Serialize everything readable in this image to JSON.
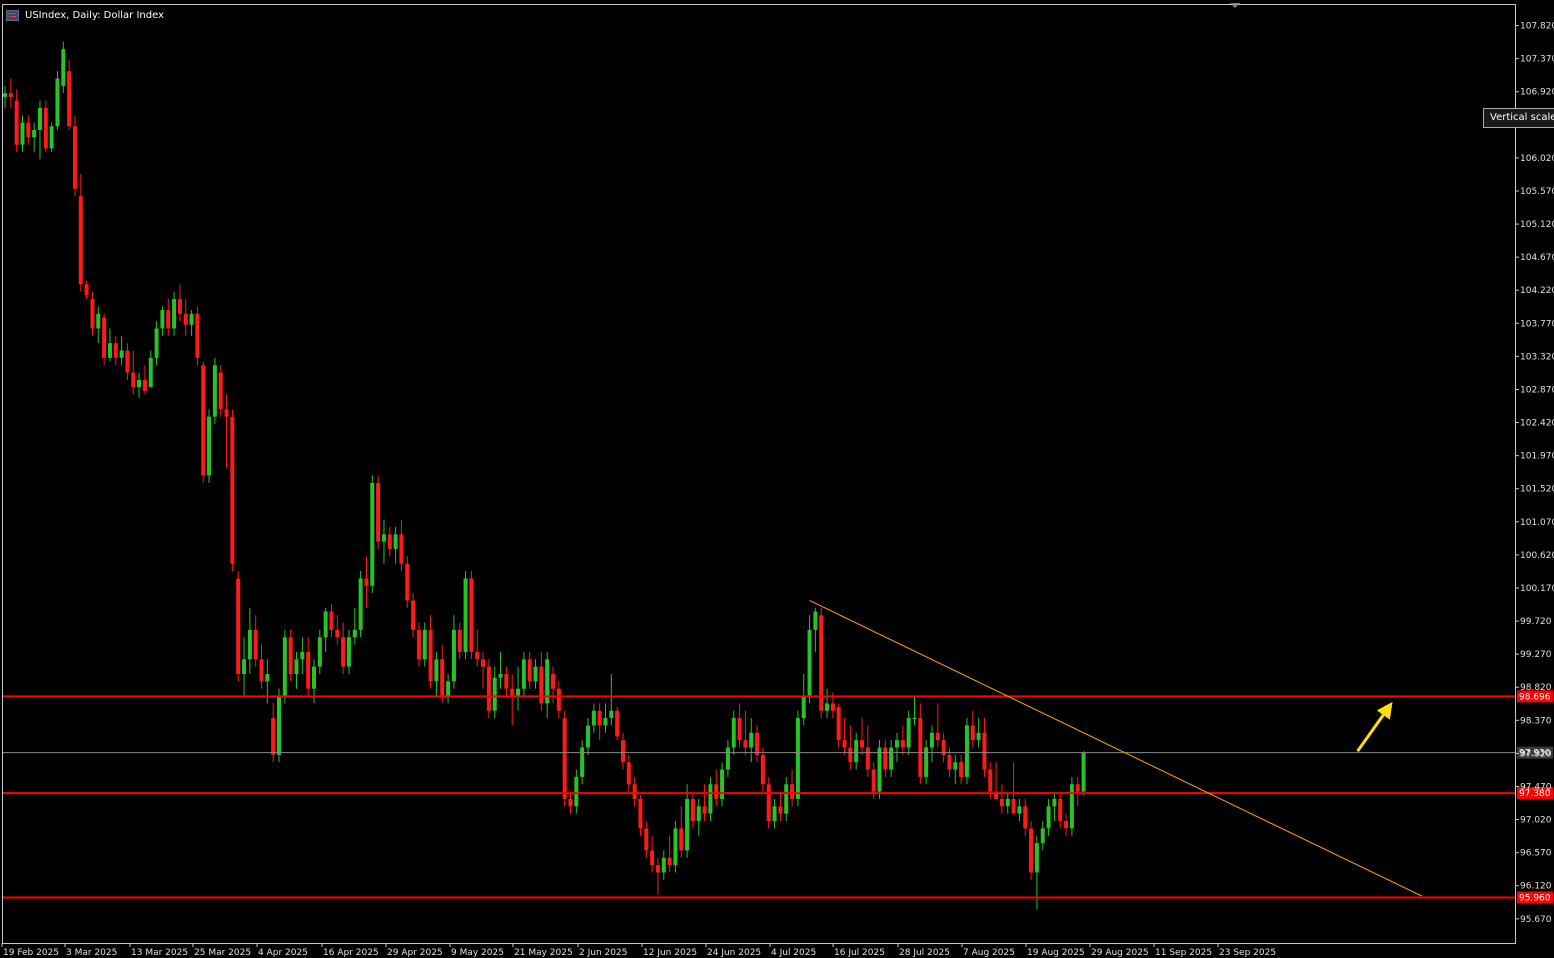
{
  "window": {
    "title": "USIndex, Daily:  Dollar Index",
    "tooltip": "Vertical scale"
  },
  "colors": {
    "background": "#000000",
    "bull_candle": "#26c426",
    "bear_candle": "#ff1a1a",
    "horizontal_level": "#ff0000",
    "trendline": "#ffa500",
    "arrow": "#ffe000",
    "current_price_line": "#8a8a8a",
    "axis": "#c8c8c8"
  },
  "chart_data": {
    "type": "candlestick",
    "symbol": "USIndex",
    "timeframe": "Daily",
    "title": "USIndex, Daily:  Dollar Index",
    "ylim": [
      95.3,
      108.1
    ],
    "y_ticks": [
      "107.820",
      "107.370",
      "106.920",
      "106.470",
      "106.020",
      "105.570",
      "105.120",
      "104.670",
      "104.220",
      "103.770",
      "103.320",
      "102.870",
      "102.420",
      "101.970",
      "101.520",
      "101.070",
      "100.620",
      "100.170",
      "99.720",
      "99.270",
      "98.820",
      "98.370",
      "97.920",
      "97.470",
      "97.020",
      "96.570",
      "96.120",
      "95.670"
    ],
    "x_ticks": [
      "19 Feb 2025",
      "3 Mar 2025",
      "13 Mar 2025",
      "25 Mar 2025",
      "4 Apr 2025",
      "16 Apr 2025",
      "29 Apr 2025",
      "9 May 2025",
      "21 May 2025",
      "2 Jun 2025",
      "12 Jun 2025",
      "24 Jun 2025",
      "4 Jul 2025",
      "16 Jul 2025",
      "28 Jul 2025",
      "7 Aug 2025",
      "19 Aug 2025",
      "29 Aug 2025",
      "11 Sep 2025",
      "23 Sep 2025"
    ],
    "grid": false,
    "horizontal_levels": [
      {
        "price": 98.696,
        "label": "98.696"
      },
      {
        "price": 97.38,
        "label": "97.380"
      },
      {
        "price": 95.96,
        "label": "95.960"
      }
    ],
    "current_price": {
      "price": 97.93,
      "label": "97.930"
    },
    "trendline": {
      "from": {
        "index": 138,
        "price": 100.0
      },
      "to": {
        "index": 243,
        "price": 95.98
      }
    },
    "arrow": {
      "from": {
        "index": 232,
        "price": 97.95
      },
      "to": {
        "index": 238,
        "price": 98.62
      }
    },
    "candles": [
      {
        "o": 106.85,
        "h": 107.0,
        "l": 106.7,
        "c": 106.9
      },
      {
        "o": 106.9,
        "h": 107.1,
        "l": 106.7,
        "c": 106.85
      },
      {
        "o": 106.8,
        "h": 106.95,
        "l": 106.1,
        "c": 106.2
      },
      {
        "o": 106.2,
        "h": 106.6,
        "l": 106.1,
        "c": 106.5
      },
      {
        "o": 106.5,
        "h": 106.6,
        "l": 106.2,
        "c": 106.3
      },
      {
        "o": 106.3,
        "h": 106.5,
        "l": 106.1,
        "c": 106.4
      },
      {
        "o": 106.4,
        "h": 106.8,
        "l": 106.0,
        "c": 106.7
      },
      {
        "o": 106.7,
        "h": 106.8,
        "l": 106.1,
        "c": 106.15
      },
      {
        "o": 106.15,
        "h": 106.5,
        "l": 106.1,
        "c": 106.45
      },
      {
        "o": 106.45,
        "h": 107.2,
        "l": 106.4,
        "c": 107.1
      },
      {
        "o": 107.0,
        "h": 107.6,
        "l": 106.9,
        "c": 107.5
      },
      {
        "o": 107.2,
        "h": 107.35,
        "l": 106.4,
        "c": 106.45
      },
      {
        "o": 106.45,
        "h": 106.6,
        "l": 105.5,
        "c": 105.6
      },
      {
        "o": 105.5,
        "h": 105.8,
        "l": 104.2,
        "c": 104.3
      },
      {
        "o": 104.3,
        "h": 104.35,
        "l": 104.1,
        "c": 104.15
      },
      {
        "o": 104.1,
        "h": 104.2,
        "l": 103.6,
        "c": 103.7
      },
      {
        "o": 103.7,
        "h": 104.0,
        "l": 103.5,
        "c": 103.9
      },
      {
        "o": 103.85,
        "h": 103.9,
        "l": 103.2,
        "c": 103.3
      },
      {
        "o": 103.3,
        "h": 103.7,
        "l": 103.25,
        "c": 103.5
      },
      {
        "o": 103.5,
        "h": 103.6,
        "l": 103.2,
        "c": 103.3
      },
      {
        "o": 103.3,
        "h": 103.6,
        "l": 103.2,
        "c": 103.4
      },
      {
        "o": 103.4,
        "h": 103.5,
        "l": 103.0,
        "c": 103.1
      },
      {
        "o": 103.1,
        "h": 103.4,
        "l": 102.8,
        "c": 102.9
      },
      {
        "o": 102.9,
        "h": 103.1,
        "l": 102.75,
        "c": 103.0
      },
      {
        "o": 103.0,
        "h": 103.2,
        "l": 102.8,
        "c": 102.85
      },
      {
        "o": 102.9,
        "h": 103.4,
        "l": 102.9,
        "c": 103.3
      },
      {
        "o": 103.3,
        "h": 103.8,
        "l": 103.2,
        "c": 103.7
      },
      {
        "o": 103.7,
        "h": 104.0,
        "l": 103.6,
        "c": 103.95
      },
      {
        "o": 103.95,
        "h": 104.1,
        "l": 103.6,
        "c": 103.7
      },
      {
        "o": 103.7,
        "h": 104.2,
        "l": 103.6,
        "c": 104.1
      },
      {
        "o": 104.1,
        "h": 104.3,
        "l": 103.8,
        "c": 103.9
      },
      {
        "o": 103.9,
        "h": 104.1,
        "l": 103.6,
        "c": 103.75
      },
      {
        "o": 103.75,
        "h": 103.95,
        "l": 103.6,
        "c": 103.9
      },
      {
        "o": 103.9,
        "h": 104.0,
        "l": 103.2,
        "c": 103.3
      },
      {
        "o": 103.2,
        "h": 103.25,
        "l": 101.6,
        "c": 101.7
      },
      {
        "o": 101.7,
        "h": 102.6,
        "l": 101.6,
        "c": 102.5
      },
      {
        "o": 102.5,
        "h": 103.3,
        "l": 102.4,
        "c": 103.2
      },
      {
        "o": 103.1,
        "h": 103.2,
        "l": 102.5,
        "c": 102.6
      },
      {
        "o": 102.6,
        "h": 102.8,
        "l": 101.8,
        "c": 102.5
      },
      {
        "o": 102.5,
        "h": 102.6,
        "l": 100.4,
        "c": 100.5
      },
      {
        "o": 100.3,
        "h": 100.4,
        "l": 98.9,
        "c": 99.0
      },
      {
        "o": 99.0,
        "h": 99.5,
        "l": 98.7,
        "c": 99.2
      },
      {
        "o": 99.2,
        "h": 99.9,
        "l": 99.0,
        "c": 99.6
      },
      {
        "o": 99.6,
        "h": 99.8,
        "l": 99.1,
        "c": 99.2
      },
      {
        "o": 99.2,
        "h": 99.4,
        "l": 98.8,
        "c": 98.9
      },
      {
        "o": 98.9,
        "h": 99.2,
        "l": 98.6,
        "c": 99.0
      },
      {
        "o": 98.4,
        "h": 98.6,
        "l": 97.8,
        "c": 97.9
      },
      {
        "o": 97.9,
        "h": 98.8,
        "l": 97.8,
        "c": 98.7
      },
      {
        "o": 98.7,
        "h": 99.6,
        "l": 98.6,
        "c": 99.5
      },
      {
        "o": 99.5,
        "h": 99.6,
        "l": 98.9,
        "c": 99.0
      },
      {
        "o": 99.0,
        "h": 99.3,
        "l": 98.8,
        "c": 99.2
      },
      {
        "o": 99.2,
        "h": 99.5,
        "l": 99.0,
        "c": 99.3
      },
      {
        "o": 99.3,
        "h": 99.5,
        "l": 98.7,
        "c": 98.8
      },
      {
        "o": 98.8,
        "h": 99.2,
        "l": 98.6,
        "c": 99.1
      },
      {
        "o": 99.1,
        "h": 99.6,
        "l": 99.0,
        "c": 99.5
      },
      {
        "o": 99.5,
        "h": 99.9,
        "l": 99.3,
        "c": 99.85
      },
      {
        "o": 99.85,
        "h": 99.95,
        "l": 99.5,
        "c": 99.6
      },
      {
        "o": 99.6,
        "h": 99.8,
        "l": 99.4,
        "c": 99.5
      },
      {
        "o": 99.5,
        "h": 99.7,
        "l": 99.0,
        "c": 99.1
      },
      {
        "o": 99.1,
        "h": 99.6,
        "l": 99.0,
        "c": 99.5
      },
      {
        "o": 99.5,
        "h": 99.9,
        "l": 99.4,
        "c": 99.6
      },
      {
        "o": 99.6,
        "h": 100.4,
        "l": 99.5,
        "c": 100.3
      },
      {
        "o": 100.3,
        "h": 100.6,
        "l": 99.9,
        "c": 100.2
      },
      {
        "o": 100.2,
        "h": 101.7,
        "l": 100.1,
        "c": 101.6
      },
      {
        "o": 101.6,
        "h": 101.7,
        "l": 100.7,
        "c": 100.8
      },
      {
        "o": 100.8,
        "h": 101.1,
        "l": 100.5,
        "c": 100.9
      },
      {
        "o": 100.9,
        "h": 101.0,
        "l": 100.6,
        "c": 100.7
      },
      {
        "o": 100.7,
        "h": 101.0,
        "l": 100.5,
        "c": 100.9
      },
      {
        "o": 100.9,
        "h": 101.1,
        "l": 100.4,
        "c": 100.5
      },
      {
        "o": 100.5,
        "h": 100.6,
        "l": 99.9,
        "c": 100.0
      },
      {
        "o": 100.0,
        "h": 100.1,
        "l": 99.5,
        "c": 99.6
      },
      {
        "o": 99.6,
        "h": 99.7,
        "l": 99.1,
        "c": 99.2
      },
      {
        "o": 99.2,
        "h": 99.7,
        "l": 99.1,
        "c": 99.6
      },
      {
        "o": 99.6,
        "h": 99.8,
        "l": 98.8,
        "c": 98.9
      },
      {
        "o": 98.9,
        "h": 99.3,
        "l": 98.7,
        "c": 99.2
      },
      {
        "o": 99.2,
        "h": 99.4,
        "l": 98.6,
        "c": 98.7
      },
      {
        "o": 98.7,
        "h": 99.0,
        "l": 98.6,
        "c": 98.9
      },
      {
        "o": 98.9,
        "h": 99.8,
        "l": 98.8,
        "c": 99.6
      },
      {
        "o": 99.6,
        "h": 99.7,
        "l": 99.2,
        "c": 99.3
      },
      {
        "o": 99.3,
        "h": 100.4,
        "l": 99.2,
        "c": 100.3
      },
      {
        "o": 100.3,
        "h": 100.4,
        "l": 99.2,
        "c": 99.3
      },
      {
        "o": 99.3,
        "h": 99.6,
        "l": 99.1,
        "c": 99.2
      },
      {
        "o": 99.2,
        "h": 99.3,
        "l": 98.8,
        "c": 99.1
      },
      {
        "o": 99.1,
        "h": 99.2,
        "l": 98.4,
        "c": 98.5
      },
      {
        "o": 98.5,
        "h": 99.1,
        "l": 98.4,
        "c": 98.95
      },
      {
        "o": 98.95,
        "h": 99.3,
        "l": 98.8,
        "c": 99.0
      },
      {
        "o": 99.0,
        "h": 99.1,
        "l": 98.7,
        "c": 98.8
      },
      {
        "o": 98.8,
        "h": 99.0,
        "l": 98.3,
        "c": 98.7
      },
      {
        "o": 98.7,
        "h": 99.1,
        "l": 98.5,
        "c": 98.8
      },
      {
        "o": 98.8,
        "h": 99.3,
        "l": 98.7,
        "c": 99.2
      },
      {
        "o": 99.2,
        "h": 99.3,
        "l": 98.8,
        "c": 98.9
      },
      {
        "o": 98.9,
        "h": 99.2,
        "l": 98.8,
        "c": 99.1
      },
      {
        "o": 99.1,
        "h": 99.3,
        "l": 98.5,
        "c": 98.6
      },
      {
        "o": 98.6,
        "h": 99.3,
        "l": 98.4,
        "c": 99.2
      },
      {
        "o": 99.0,
        "h": 99.1,
        "l": 98.6,
        "c": 98.8
      },
      {
        "o": 98.8,
        "h": 98.9,
        "l": 98.4,
        "c": 98.5
      },
      {
        "o": 98.4,
        "h": 98.5,
        "l": 97.2,
        "c": 97.3
      },
      {
        "o": 97.3,
        "h": 97.4,
        "l": 97.1,
        "c": 97.2
      },
      {
        "o": 97.2,
        "h": 97.7,
        "l": 97.1,
        "c": 97.6
      },
      {
        "o": 97.6,
        "h": 98.1,
        "l": 97.5,
        "c": 98.0
      },
      {
        "o": 98.0,
        "h": 98.4,
        "l": 97.9,
        "c": 98.3
      },
      {
        "o": 98.3,
        "h": 98.6,
        "l": 98.2,
        "c": 98.5
      },
      {
        "o": 98.5,
        "h": 98.6,
        "l": 98.1,
        "c": 98.3
      },
      {
        "o": 98.3,
        "h": 98.6,
        "l": 98.2,
        "c": 98.4
      },
      {
        "o": 98.4,
        "h": 99.0,
        "l": 98.3,
        "c": 98.5
      },
      {
        "o": 98.5,
        "h": 98.55,
        "l": 98.1,
        "c": 98.15
      },
      {
        "o": 98.1,
        "h": 98.2,
        "l": 97.7,
        "c": 97.8
      },
      {
        "o": 97.8,
        "h": 97.9,
        "l": 97.4,
        "c": 97.5
      },
      {
        "o": 97.5,
        "h": 97.6,
        "l": 97.2,
        "c": 97.3
      },
      {
        "o": 97.3,
        "h": 97.35,
        "l": 96.8,
        "c": 96.9
      },
      {
        "o": 96.9,
        "h": 97.0,
        "l": 96.5,
        "c": 96.6
      },
      {
        "o": 96.6,
        "h": 96.8,
        "l": 96.3,
        "c": 96.4
      },
      {
        "o": 96.4,
        "h": 96.5,
        "l": 96.0,
        "c": 96.3
      },
      {
        "o": 96.3,
        "h": 96.6,
        "l": 96.2,
        "c": 96.5
      },
      {
        "o": 96.5,
        "h": 96.8,
        "l": 96.3,
        "c": 96.4
      },
      {
        "o": 96.4,
        "h": 97.0,
        "l": 96.3,
        "c": 96.9
      },
      {
        "o": 96.9,
        "h": 97.2,
        "l": 96.5,
        "c": 96.6
      },
      {
        "o": 96.6,
        "h": 97.5,
        "l": 96.5,
        "c": 97.3
      },
      {
        "o": 97.3,
        "h": 97.4,
        "l": 96.9,
        "c": 97.0
      },
      {
        "o": 97.0,
        "h": 97.3,
        "l": 96.8,
        "c": 97.2
      },
      {
        "o": 97.2,
        "h": 97.5,
        "l": 97.0,
        "c": 97.1
      },
      {
        "o": 97.1,
        "h": 97.6,
        "l": 97.0,
        "c": 97.5
      },
      {
        "o": 97.5,
        "h": 97.7,
        "l": 97.2,
        "c": 97.3
      },
      {
        "o": 97.3,
        "h": 97.8,
        "l": 97.2,
        "c": 97.7
      },
      {
        "o": 97.7,
        "h": 98.1,
        "l": 97.6,
        "c": 98.0
      },
      {
        "o": 98.0,
        "h": 98.5,
        "l": 97.9,
        "c": 98.4
      },
      {
        "o": 98.4,
        "h": 98.6,
        "l": 98.0,
        "c": 98.1
      },
      {
        "o": 98.1,
        "h": 98.5,
        "l": 97.9,
        "c": 98.0
      },
      {
        "o": 98.0,
        "h": 98.4,
        "l": 97.8,
        "c": 98.2
      },
      {
        "o": 98.2,
        "h": 98.3,
        "l": 97.8,
        "c": 97.9
      },
      {
        "o": 97.9,
        "h": 98.0,
        "l": 97.4,
        "c": 97.5
      },
      {
        "o": 97.5,
        "h": 97.6,
        "l": 96.9,
        "c": 97.0
      },
      {
        "o": 97.0,
        "h": 97.3,
        "l": 96.9,
        "c": 97.2
      },
      {
        "o": 97.2,
        "h": 97.4,
        "l": 97.0,
        "c": 97.1
      },
      {
        "o": 97.1,
        "h": 97.6,
        "l": 97.0,
        "c": 97.5
      },
      {
        "o": 97.5,
        "h": 97.7,
        "l": 97.2,
        "c": 97.3
      },
      {
        "o": 97.3,
        "h": 98.5,
        "l": 97.2,
        "c": 98.4
      },
      {
        "o": 98.4,
        "h": 99.0,
        "l": 98.3,
        "c": 98.7
      },
      {
        "o": 98.7,
        "h": 99.8,
        "l": 98.6,
        "c": 99.6
      },
      {
        "o": 99.6,
        "h": 99.9,
        "l": 99.3,
        "c": 99.85
      },
      {
        "o": 99.8,
        "h": 99.9,
        "l": 98.4,
        "c": 98.5
      },
      {
        "o": 98.5,
        "h": 98.8,
        "l": 98.4,
        "c": 98.6
      },
      {
        "o": 98.6,
        "h": 98.75,
        "l": 98.4,
        "c": 98.5
      },
      {
        "o": 98.55,
        "h": 98.6,
        "l": 98.0,
        "c": 98.1
      },
      {
        "o": 98.1,
        "h": 98.4,
        "l": 97.9,
        "c": 98.0
      },
      {
        "o": 98.0,
        "h": 98.3,
        "l": 97.7,
        "c": 97.8
      },
      {
        "o": 97.8,
        "h": 98.2,
        "l": 97.7,
        "c": 98.1
      },
      {
        "o": 98.1,
        "h": 98.4,
        "l": 97.9,
        "c": 98.0
      },
      {
        "o": 98.0,
        "h": 98.3,
        "l": 97.6,
        "c": 97.7
      },
      {
        "o": 97.7,
        "h": 97.8,
        "l": 97.3,
        "c": 97.4
      },
      {
        "o": 97.4,
        "h": 98.1,
        "l": 97.3,
        "c": 98.0
      },
      {
        "o": 98.0,
        "h": 98.1,
        "l": 97.6,
        "c": 97.7
      },
      {
        "o": 97.7,
        "h": 98.1,
        "l": 97.6,
        "c": 98.0
      },
      {
        "o": 98.0,
        "h": 98.2,
        "l": 97.8,
        "c": 98.1
      },
      {
        "o": 98.1,
        "h": 98.3,
        "l": 97.9,
        "c": 98.0
      },
      {
        "o": 98.0,
        "h": 98.5,
        "l": 97.9,
        "c": 98.4
      },
      {
        "o": 98.4,
        "h": 98.7,
        "l": 98.3,
        "c": 98.4
      },
      {
        "o": 98.4,
        "h": 98.6,
        "l": 97.5,
        "c": 97.6
      },
      {
        "o": 97.6,
        "h": 98.1,
        "l": 97.5,
        "c": 98.0
      },
      {
        "o": 98.0,
        "h": 98.3,
        "l": 97.8,
        "c": 98.2
      },
      {
        "o": 98.2,
        "h": 98.6,
        "l": 98.0,
        "c": 98.1
      },
      {
        "o": 98.1,
        "h": 98.2,
        "l": 97.8,
        "c": 97.9
      },
      {
        "o": 97.9,
        "h": 98.0,
        "l": 97.6,
        "c": 97.7
      },
      {
        "o": 97.7,
        "h": 97.9,
        "l": 97.5,
        "c": 97.8
      },
      {
        "o": 97.8,
        "h": 97.9,
        "l": 97.5,
        "c": 97.6
      },
      {
        "o": 97.6,
        "h": 98.4,
        "l": 97.5,
        "c": 98.3
      },
      {
        "o": 98.3,
        "h": 98.5,
        "l": 98.0,
        "c": 98.1
      },
      {
        "o": 98.1,
        "h": 98.4,
        "l": 98.0,
        "c": 98.2
      },
      {
        "o": 98.2,
        "h": 98.4,
        "l": 97.6,
        "c": 97.7
      },
      {
        "o": 97.7,
        "h": 97.8,
        "l": 97.3,
        "c": 97.4
      },
      {
        "o": 97.4,
        "h": 97.8,
        "l": 97.3,
        "c": 97.3
      },
      {
        "o": 97.3,
        "h": 97.5,
        "l": 97.1,
        "c": 97.2
      },
      {
        "o": 97.2,
        "h": 97.4,
        "l": 97.1,
        "c": 97.3
      },
      {
        "o": 97.3,
        "h": 97.8,
        "l": 97.2,
        "c": 97.1
      },
      {
        "o": 97.1,
        "h": 97.3,
        "l": 97.0,
        "c": 97.2
      },
      {
        "o": 97.2,
        "h": 97.3,
        "l": 96.8,
        "c": 96.9
      },
      {
        "o": 96.9,
        "h": 97.0,
        "l": 96.2,
        "c": 96.3
      },
      {
        "o": 96.3,
        "h": 96.8,
        "l": 95.8,
        "c": 96.7
      },
      {
        "o": 96.7,
        "h": 97.0,
        "l": 96.6,
        "c": 96.9
      },
      {
        "o": 96.9,
        "h": 97.3,
        "l": 96.8,
        "c": 97.2
      },
      {
        "o": 97.2,
        "h": 97.4,
        "l": 97.0,
        "c": 97.3
      },
      {
        "o": 97.3,
        "h": 97.4,
        "l": 96.9,
        "c": 97.0
      },
      {
        "o": 97.0,
        "h": 97.1,
        "l": 96.8,
        "c": 96.9
      },
      {
        "o": 96.9,
        "h": 97.6,
        "l": 96.8,
        "c": 97.5
      },
      {
        "o": 97.5,
        "h": 97.6,
        "l": 97.2,
        "c": 97.4
      },
      {
        "o": 97.4,
        "h": 97.95,
        "l": 97.35,
        "c": 97.93
      }
    ]
  }
}
